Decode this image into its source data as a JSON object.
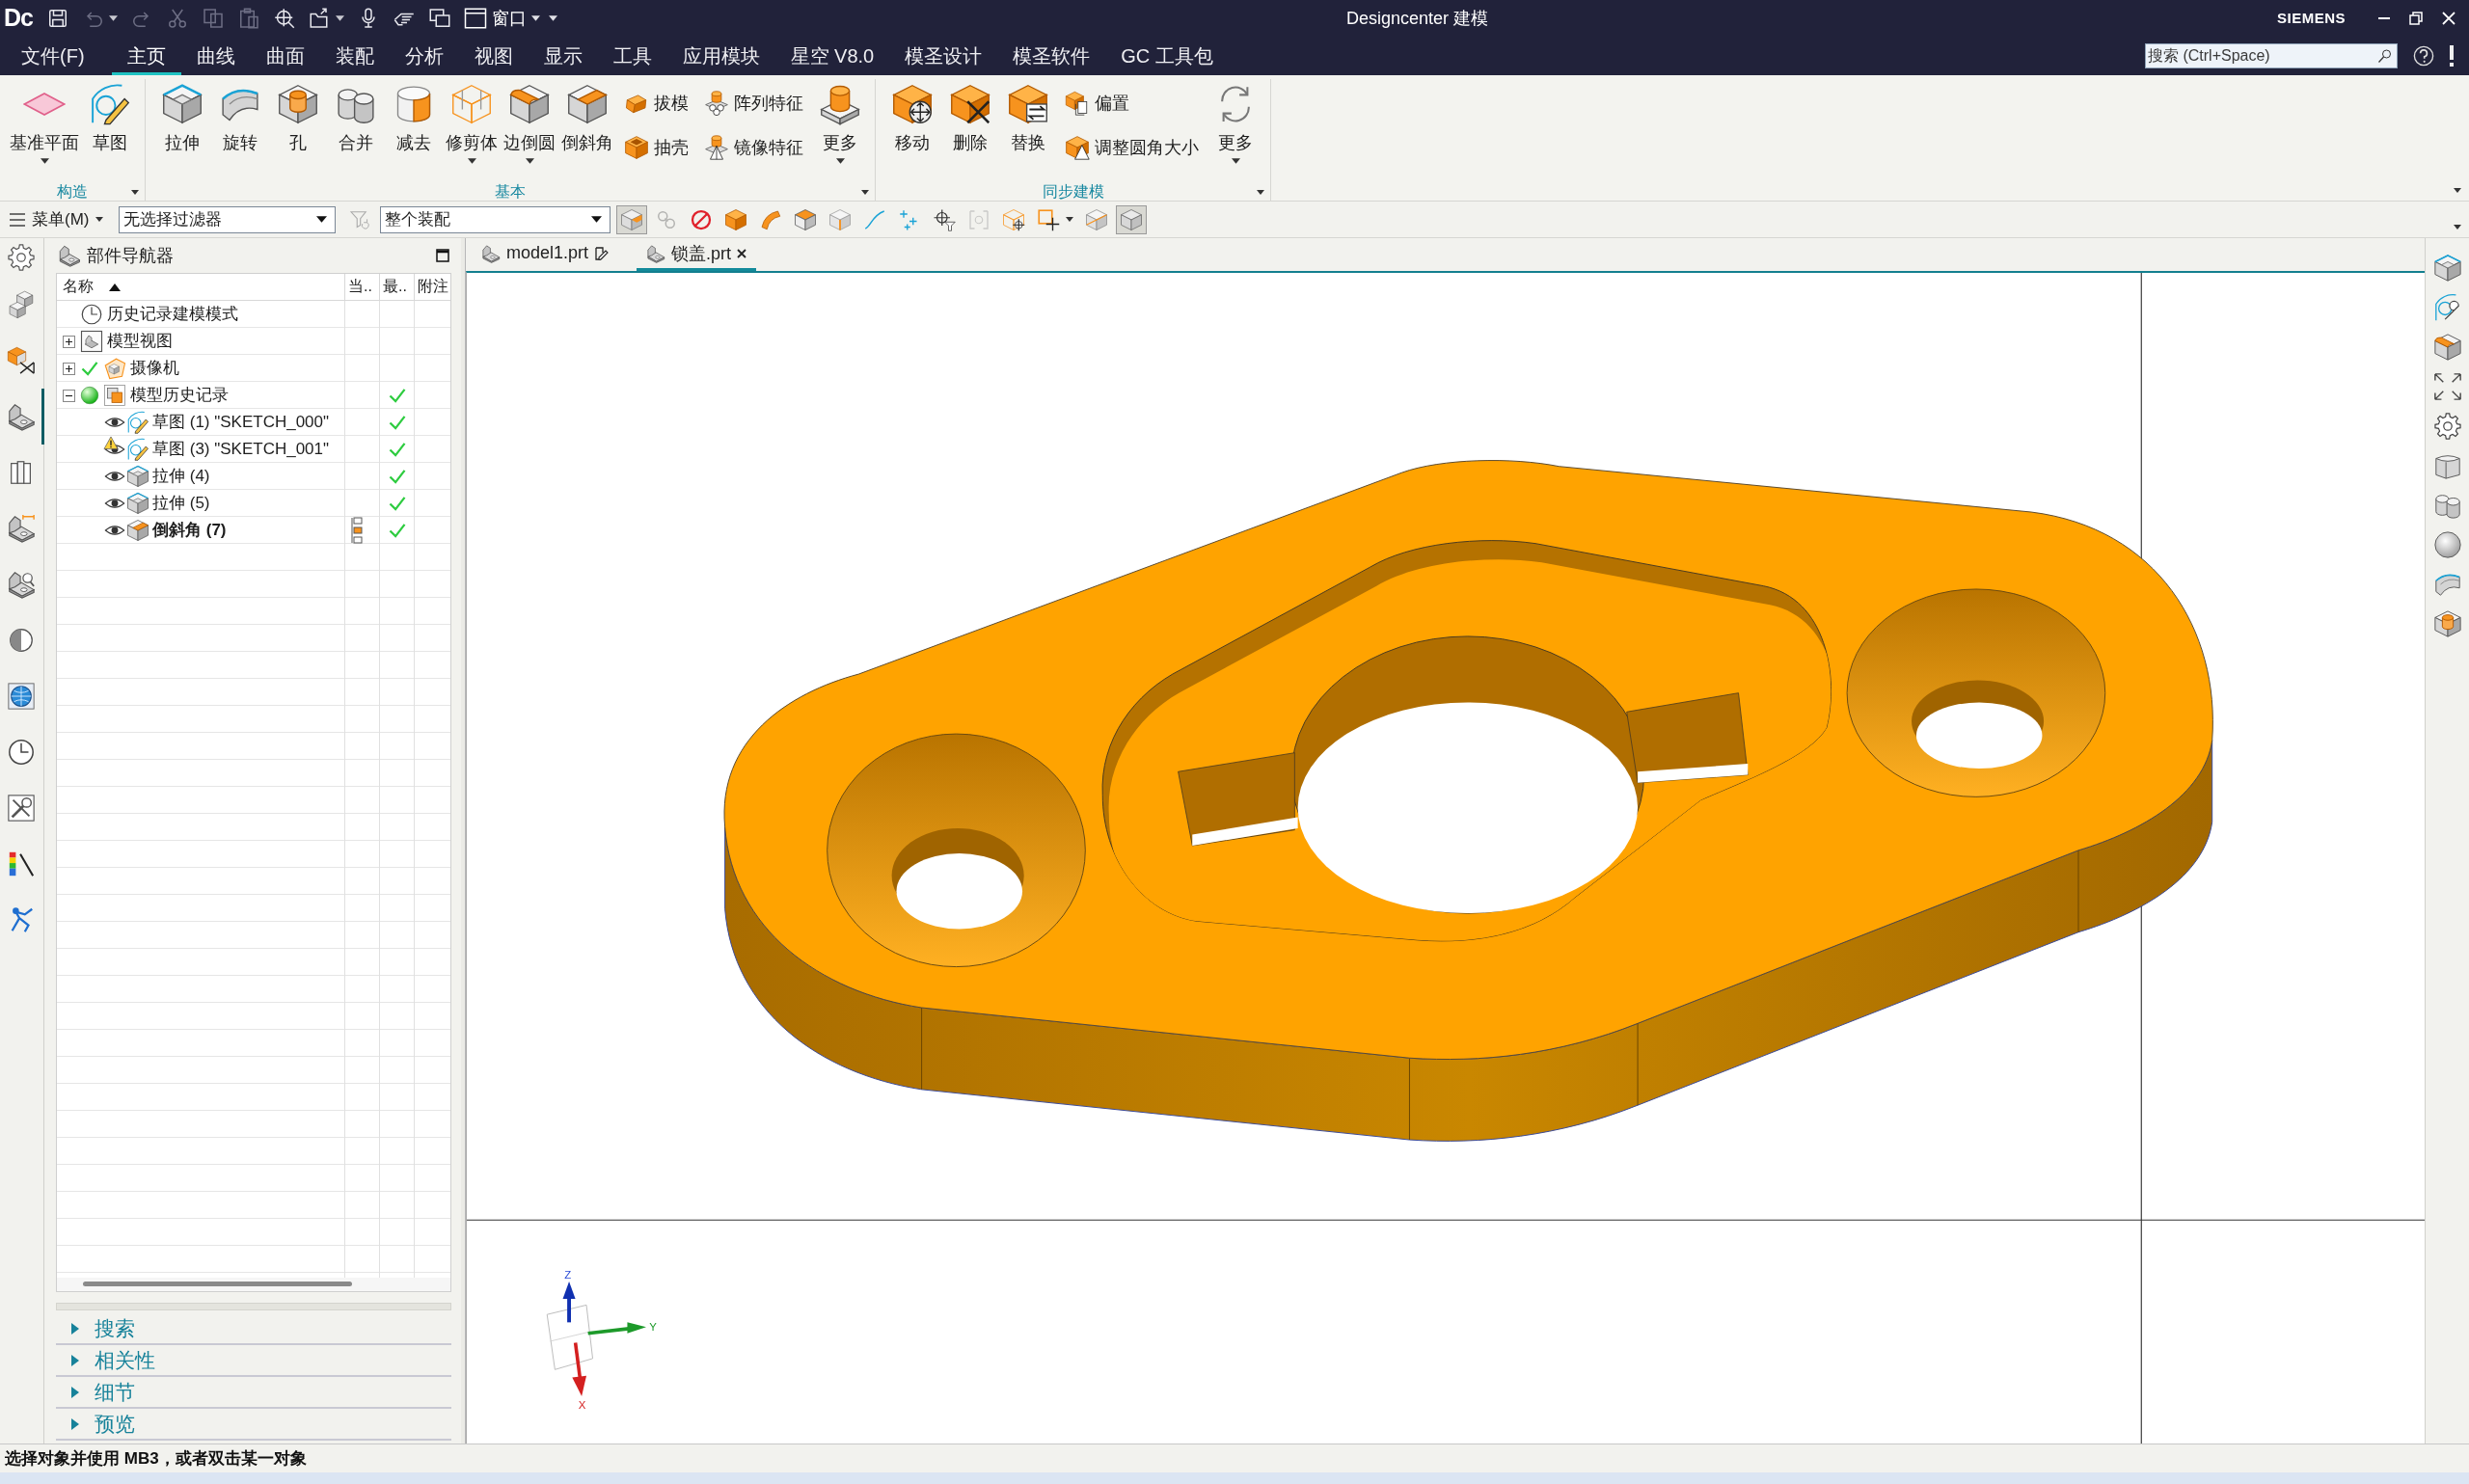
{
  "window": {
    "logo": "Dc",
    "title": "Designcenter 建模",
    "brand": "SIEMENS",
    "window_menu": "窗口"
  },
  "quick_access": [
    {
      "disabled": false
    },
    {
      "disabled": true
    },
    {
      "disabled": true
    },
    {
      "disabled": true
    },
    {
      "disabled": true
    },
    {
      "disabled": true
    },
    {
      "disabled": false
    },
    {
      "disabled": false
    },
    {
      "disabled": false
    },
    {
      "disabled": false
    },
    {
      "disabled": false
    }
  ],
  "menu_tabs": [
    {
      "label": "文件(F)",
      "selected": false
    },
    {
      "label": "主页",
      "selected": true
    },
    {
      "label": "曲线",
      "selected": false
    },
    {
      "label": "曲面",
      "selected": false
    },
    {
      "label": "装配",
      "selected": false
    },
    {
      "label": "分析",
      "selected": false
    },
    {
      "label": "视图",
      "selected": false
    },
    {
      "label": "显示",
      "selected": false
    },
    {
      "label": "工具",
      "selected": false
    },
    {
      "label": "应用模块",
      "selected": false
    },
    {
      "label": "星空 V8.0",
      "selected": false
    },
    {
      "label": "模圣设计",
      "selected": false
    },
    {
      "label": "模圣软件",
      "selected": false
    },
    {
      "label": "GC 工具包",
      "selected": false
    }
  ],
  "search": {
    "placeholder": "搜索 (Ctrl+Space)"
  },
  "ribbon": [
    {
      "title": "构造",
      "items": [
        {
          "kind": "large",
          "label": "基准平面",
          "dropdown": true
        },
        {
          "kind": "large",
          "label": "草图",
          "dropdown": false
        }
      ]
    },
    {
      "title": "基本",
      "items": [
        {
          "kind": "large",
          "label": "拉伸",
          "dropdown": false
        },
        {
          "kind": "large",
          "label": "旋转",
          "dropdown": false
        },
        {
          "kind": "large",
          "label": "孔",
          "dropdown": false
        },
        {
          "kind": "large",
          "label": "合并",
          "dropdown": false
        },
        {
          "kind": "large",
          "label": "减去",
          "dropdown": false
        },
        {
          "kind": "large",
          "label": "修剪体",
          "dropdown": true
        },
        {
          "kind": "large",
          "label": "边倒圆",
          "dropdown": true
        },
        {
          "kind": "large",
          "label": "倒斜角",
          "dropdown": false
        },
        {
          "kind": "small",
          "label": "拔模",
          "dropdown": false
        },
        {
          "kind": "small",
          "label": "抽壳",
          "dropdown": false
        },
        {
          "kind": "small",
          "label": "阵列特征",
          "dropdown": false
        },
        {
          "kind": "small",
          "label": "镜像特征",
          "dropdown": false
        },
        {
          "kind": "large",
          "label": "更多",
          "dropdown": true
        }
      ]
    },
    {
      "title": "同步建模",
      "items": [
        {
          "kind": "large",
          "label": "移动",
          "dropdown": false
        },
        {
          "kind": "large",
          "label": "删除",
          "dropdown": false
        },
        {
          "kind": "large",
          "label": "替换",
          "dropdown": false
        },
        {
          "kind": "small",
          "label": "偏置",
          "dropdown": false
        },
        {
          "kind": "small",
          "label": "调整圆角大小",
          "dropdown": false
        },
        {
          "kind": "large",
          "label": "更多",
          "dropdown": true
        }
      ]
    }
  ],
  "filter_bar": {
    "menu": "菜单(M)",
    "selection_filter": "无选择过滤器",
    "scope": "整个装配"
  },
  "selection_tools": [
    {
      "on": true,
      "disabled": false
    },
    {
      "on": false,
      "disabled": true
    },
    {
      "on": false,
      "disabled": false
    },
    {
      "on": false,
      "disabled": false
    },
    {
      "on": false,
      "disabled": false
    },
    {
      "on": false,
      "disabled": false
    },
    {
      "on": false,
      "disabled": false
    },
    {
      "on": false,
      "disabled": false
    },
    {
      "on": false,
      "disabled": false
    },
    {
      "on": false,
      "disabled": false
    },
    {
      "on": false,
      "disabled": true
    },
    {
      "on": false,
      "disabled": false
    },
    {
      "on": false,
      "disabled": false
    },
    {
      "on": false,
      "disabled": false
    },
    {
      "on": true,
      "disabled": false
    }
  ],
  "resource_bar": [
    {
      "selected": false
    },
    {
      "selected": false
    },
    {
      "selected": false
    },
    {
      "selected": true
    },
    {
      "selected": false
    },
    {
      "selected": false
    },
    {
      "selected": false
    },
    {
      "selected": false
    },
    {
      "selected": false
    },
    {
      "selected": false
    },
    {
      "selected": false
    },
    {
      "selected": false
    },
    {
      "selected": false
    }
  ],
  "navigator": {
    "title": "部件导航器",
    "columns": [
      {
        "label": "名称",
        "sorted_ascending": true
      },
      {
        "label": "当..",
        "sorted_ascending": false
      },
      {
        "label": "最..",
        "sorted_ascending": false
      },
      {
        "label": "附注",
        "sorted_ascending": false
      }
    ],
    "rows": [
      {
        "label": "历史记录建模模式",
        "kind": "mode",
        "checked": false,
        "current": false,
        "up_to_date": false
      },
      {
        "label": "模型视图",
        "kind": "view",
        "expanded": false,
        "checked": false,
        "current": false,
        "up_to_date": false
      },
      {
        "label": "摄像机",
        "kind": "camera",
        "expanded": false,
        "checked": true,
        "current": false,
        "up_to_date": false
      },
      {
        "label": "模型历史记录",
        "kind": "history",
        "expanded": true,
        "checked": false,
        "current": false,
        "up_to_date": true,
        "children": [
          {
            "label": "草图 (1) \"SKETCH_000\"",
            "kind": "sketch",
            "warning": false,
            "current": false,
            "up_to_date": true
          },
          {
            "label": "草图 (3) \"SKETCH_001\"",
            "kind": "sketch",
            "warning": true,
            "current": false,
            "up_to_date": true
          },
          {
            "label": "拉伸 (4)",
            "kind": "extrude",
            "warning": false,
            "current": false,
            "up_to_date": true
          },
          {
            "label": "拉伸 (5)",
            "kind": "extrude",
            "warning": false,
            "current": false,
            "up_to_date": true
          },
          {
            "label": "倒斜角 (7)",
            "kind": "chamfer",
            "warning": false,
            "current": true,
            "up_to_date": true
          }
        ]
      }
    ]
  },
  "panels": [
    {
      "label": "搜索",
      "expanded": false
    },
    {
      "label": "相关性",
      "expanded": false
    },
    {
      "label": "细节",
      "expanded": false
    },
    {
      "label": "预览",
      "expanded": false
    }
  ],
  "doc_tabs": [
    {
      "label": "model1.prt",
      "selected": false,
      "edited": true
    },
    {
      "label": "锁盖.prt",
      "selected": true,
      "edited": false
    }
  ],
  "triad": {
    "z": "Z",
    "y": "Y",
    "x": "X"
  },
  "status_bar": "选择对象并使用 MB3，或者双击某一对象"
}
